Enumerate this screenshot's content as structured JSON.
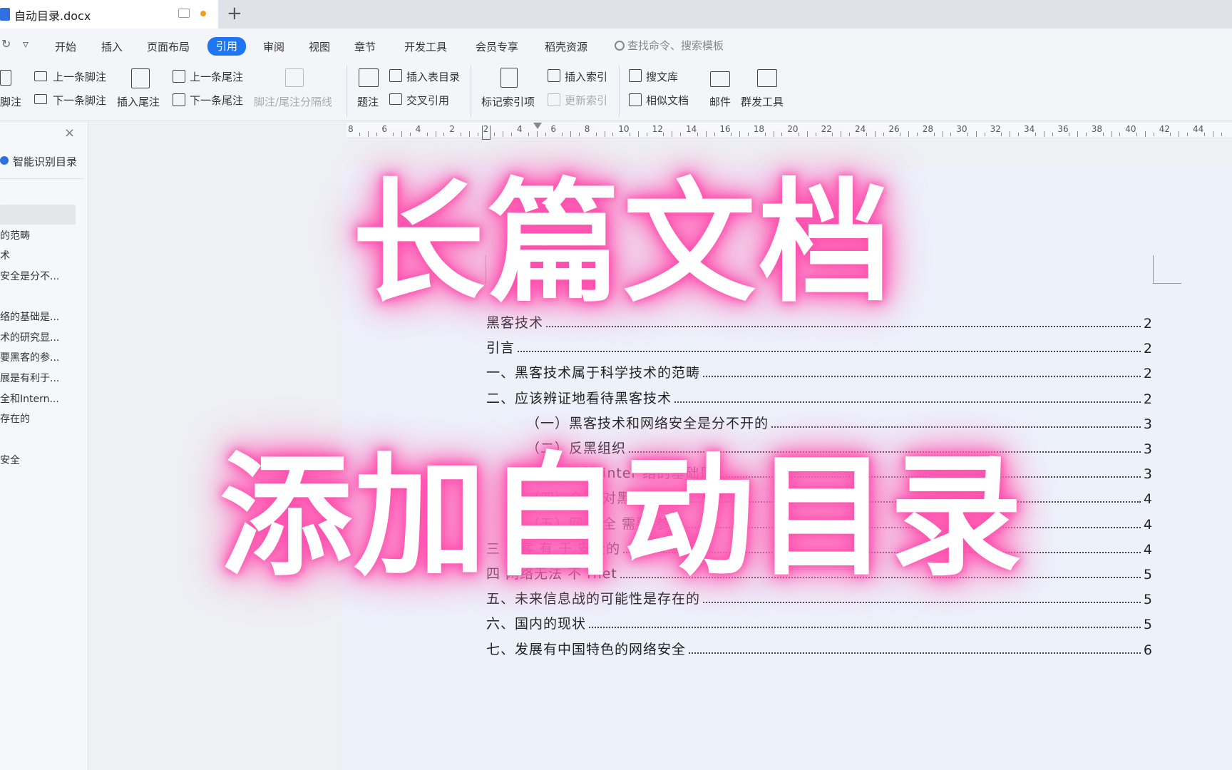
{
  "window": {
    "doc_title": "自动目录.docx",
    "new_tab": "+"
  },
  "menu": {
    "undo_icon": "↻",
    "more_icon": "▿",
    "tabs": [
      "开始",
      "插入",
      "页面布局",
      "引用",
      "审阅",
      "视图",
      "章节",
      "开发工具",
      "会员专享",
      "稻壳资源"
    ],
    "active_tab": "引用",
    "search_placeholder": "查找命令、搜索模板"
  },
  "ribbon": {
    "insert_footnote": "脚注",
    "prev_footnote": "上一条脚注",
    "next_footnote": "下一条脚注",
    "insert_endnote": "插入尾注",
    "prev_endnote": "上一条尾注",
    "next_endnote": "下一条尾注",
    "separator": "脚注/尾注分隔线",
    "caption": "题注",
    "insert_table_of_figures": "插入表目录",
    "cross_reference": "交叉引用",
    "mark_index_entry": "标记索引项",
    "insert_index": "插入索引",
    "update_index": "更新索引",
    "search_library": "搜文库",
    "similar_docs": "相似文档",
    "mail": "邮件",
    "mass_tools": "群发工具"
  },
  "ruler": {
    "labels": [
      "8",
      "6",
      "4",
      "2",
      "2",
      "4",
      "6",
      "8",
      "10",
      "12",
      "14",
      "16",
      "18",
      "20",
      "22",
      "24",
      "26",
      "28",
      "30",
      "32",
      "34",
      "36",
      "38",
      "40",
      "42",
      "44"
    ]
  },
  "navpane": {
    "smart_toc": "智能识别目录",
    "close_icon": "×",
    "items": [
      "的范畴",
      "术",
      "安全是分不...",
      "络的基础是...",
      "术的研究显...",
      "要黑客的参...",
      "展是有利于...",
      "全和Intern...",
      "存在的",
      "安全"
    ]
  },
  "toc": {
    "entries": [
      {
        "text": "黑客技术",
        "page": "2",
        "level": 1
      },
      {
        "text": "引言",
        "page": "2",
        "level": 1
      },
      {
        "text": "一、黑客技术属于科学技术的范畴",
        "page": "2",
        "level": 1
      },
      {
        "text": "二、应该辨证地看待黑客技术",
        "page": "2",
        "level": 1
      },
      {
        "text": "（一）黑客技术和网络安全是分不开的",
        "page": "3",
        "level": 2
      },
      {
        "text": "（二）反黑组织",
        "page": "3",
        "level": 2
      },
      {
        "text": "（三）目前 inter  络的基础是",
        "page": "3",
        "level": 2
      },
      {
        "text": "（四）全  界对黑客技    显",
        "page": "4",
        "level": 2
      },
      {
        "text": "（五）网  安全  需要    参",
        "page": "4",
        "level": 2
      },
      {
        "text": "三      黑客    有  于   安全的",
        "page": "4",
        "level": 1
      },
      {
        "text": "四        网络无法  不    rnet",
        "page": "5",
        "level": 1
      },
      {
        "text": "五、未来信息战的可能性是存在的",
        "page": "5",
        "level": 1
      },
      {
        "text": "六、国内的现状",
        "page": "5",
        "level": 1
      },
      {
        "text": "七、发展有中国特色的网络安全",
        "page": "6",
        "level": 1
      }
    ]
  },
  "overlay": {
    "line1": "长篇文档",
    "line2": "添加自动目录"
  },
  "colors": {
    "accent": "#1f76f3",
    "glow": "#ff4fae",
    "page": "#edf2fa"
  }
}
